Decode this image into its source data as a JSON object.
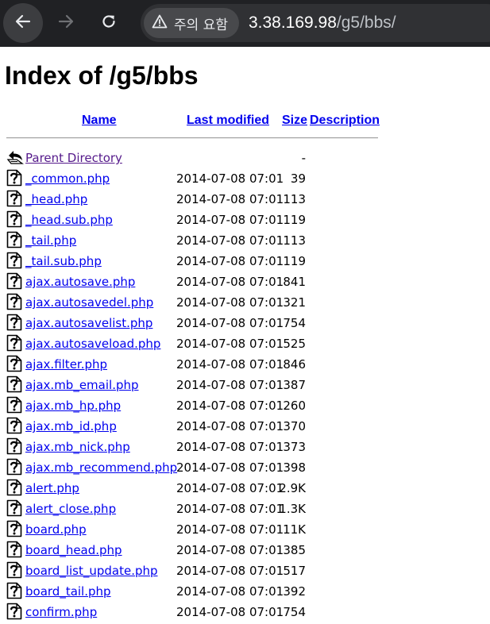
{
  "browser": {
    "warning_label": "주의 요함",
    "url_host": "3.38.169.98",
    "url_path": "/g5/bbs/"
  },
  "page": {
    "title": "Index of /g5/bbs",
    "columns": {
      "name": "Name",
      "last_modified": "Last modified",
      "size": "Size",
      "description": "Description"
    },
    "parent": {
      "name": "Parent Directory",
      "size": "-"
    },
    "files": [
      {
        "name": "_common.php",
        "date": "2014-07-08 07:01",
        "size": "39"
      },
      {
        "name": "_head.php",
        "date": "2014-07-08 07:01",
        "size": "113"
      },
      {
        "name": "_head.sub.php",
        "date": "2014-07-08 07:01",
        "size": "119"
      },
      {
        "name": "_tail.php",
        "date": "2014-07-08 07:01",
        "size": "113"
      },
      {
        "name": "_tail.sub.php",
        "date": "2014-07-08 07:01",
        "size": "119"
      },
      {
        "name": "ajax.autosave.php",
        "date": "2014-07-08 07:01",
        "size": "841"
      },
      {
        "name": "ajax.autosavedel.php",
        "date": "2014-07-08 07:01",
        "size": "321"
      },
      {
        "name": "ajax.autosavelist.php",
        "date": "2014-07-08 07:01",
        "size": "754"
      },
      {
        "name": "ajax.autosaveload.php",
        "date": "2014-07-08 07:01",
        "size": "525"
      },
      {
        "name": "ajax.filter.php",
        "date": "2014-07-08 07:01",
        "size": "846"
      },
      {
        "name": "ajax.mb_email.php",
        "date": "2014-07-08 07:01",
        "size": "387"
      },
      {
        "name": "ajax.mb_hp.php",
        "date": "2014-07-08 07:01",
        "size": "260"
      },
      {
        "name": "ajax.mb_id.php",
        "date": "2014-07-08 07:01",
        "size": "370"
      },
      {
        "name": "ajax.mb_nick.php",
        "date": "2014-07-08 07:01",
        "size": "373"
      },
      {
        "name": "ajax.mb_recommend.php",
        "date": "2014-07-08 07:01",
        "size": "398"
      },
      {
        "name": "alert.php",
        "date": "2014-07-08 07:01",
        "size": "2.9K"
      },
      {
        "name": "alert_close.php",
        "date": "2014-07-08 07:01",
        "size": "1.3K"
      },
      {
        "name": "board.php",
        "date": "2014-07-08 07:01",
        "size": "11K"
      },
      {
        "name": "board_head.php",
        "date": "2014-07-08 07:01",
        "size": "385"
      },
      {
        "name": "board_list_update.php",
        "date": "2014-07-08 07:01",
        "size": "517"
      },
      {
        "name": "board_tail.php",
        "date": "2014-07-08 07:01",
        "size": "392"
      },
      {
        "name": "confirm.php",
        "date": "2014-07-08 07:01",
        "size": "754"
      }
    ]
  }
}
